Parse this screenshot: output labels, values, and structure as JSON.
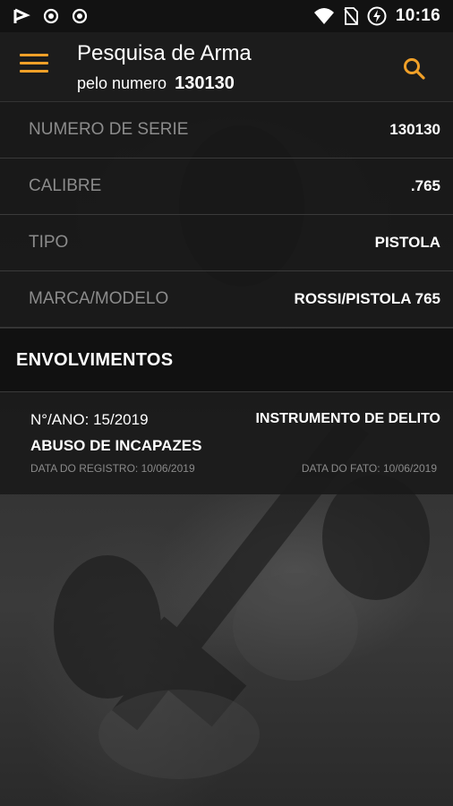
{
  "status_bar": {
    "time": "10:16",
    "left_icons": [
      "flag-icon",
      "record-icon",
      "record-icon"
    ],
    "right_icons": [
      "wifi-icon",
      "no-sim-icon",
      "battery-charging-icon"
    ]
  },
  "app_bar": {
    "title": "Pesquisa de Arma",
    "subtitle_prefix": "pelo numero",
    "subtitle_number": "130130",
    "menu_icon": "hamburger-menu-icon",
    "search_icon": "search-icon",
    "accent_color": "#f0a028"
  },
  "details": [
    {
      "label": "NUMERO DE SERIE",
      "value": "130130"
    },
    {
      "label": "CALIBRE",
      "value": ".765"
    },
    {
      "label": "TIPO",
      "value": "PISTOLA"
    },
    {
      "label": "MARCA/MODELO",
      "value": "ROSSI/PISTOLA 765"
    }
  ],
  "section": {
    "title": "ENVOLVIMENTOS"
  },
  "involvements": [
    {
      "number_year": "N°/ANO: 15/2019",
      "category": "INSTRUMENTO DE DELITO",
      "crime": "ABUSO DE INCAPAZES",
      "registry_date": "DATA DO REGISTRO: 10/06/2019",
      "fact_date": "DATA DO FATO: 10/06/2019"
    }
  ]
}
